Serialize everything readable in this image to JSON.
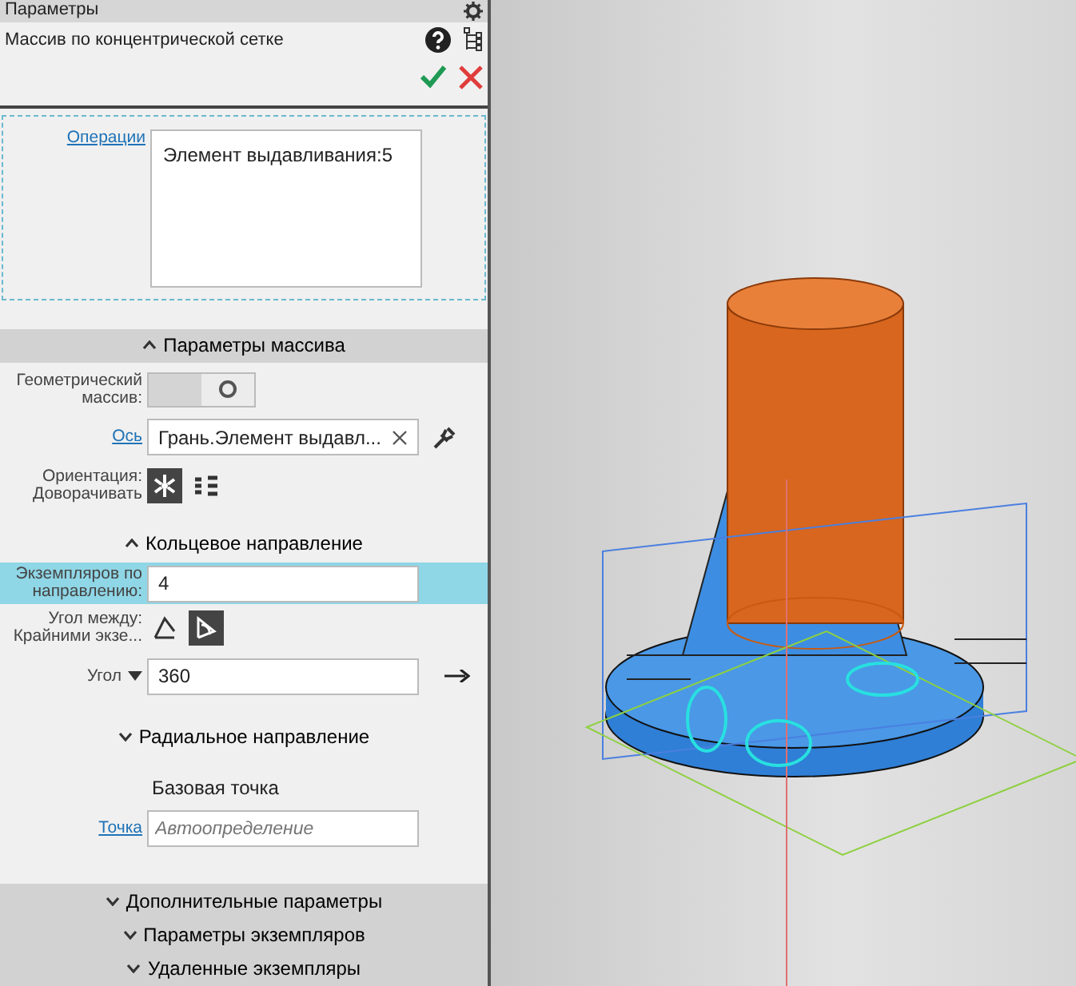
{
  "panel": {
    "title": "Параметры",
    "subtitle": "Массив по концентрической сетке"
  },
  "operations": {
    "label": "Операции",
    "items": [
      "Элемент выдавливания:5"
    ]
  },
  "array_section": {
    "title": "Параметры массива",
    "expanded": true
  },
  "geometric": {
    "label": "Геометрический массив:",
    "on": false
  },
  "axis": {
    "label": "Ось",
    "value": "Грань.Элемент выдавл..."
  },
  "orientation": {
    "label": "Ориентация:",
    "sublabel": "Доворачивать",
    "options": [
      {
        "kind": "rotate",
        "selected": true
      },
      {
        "kind": "parallel",
        "selected": false
      }
    ]
  },
  "ring_section": {
    "title": "Кольцевое направление",
    "expanded": true
  },
  "count": {
    "label": "Экземпляров по направлению:",
    "value": "4",
    "highlighted": true
  },
  "angle_between": {
    "label": "Угол между:",
    "sublabel": "Крайними экзе...",
    "options": [
      {
        "kind": "step",
        "selected": false
      },
      {
        "kind": "total",
        "selected": true
      }
    ]
  },
  "angle": {
    "label": "Угол",
    "value": "360"
  },
  "radial_section": {
    "title": "Радиальное направление",
    "expanded": false
  },
  "base_point": {
    "heading": "Базовая точка",
    "label": "Точка",
    "placeholder": "Автоопределение"
  },
  "collapsed_sections": [
    {
      "title": "Дополнительные параметры",
      "expanded": false
    },
    {
      "title": "Параметры экземпляров",
      "expanded": false
    },
    {
      "title": "Удаленные экземпляры",
      "expanded": false
    }
  ]
}
